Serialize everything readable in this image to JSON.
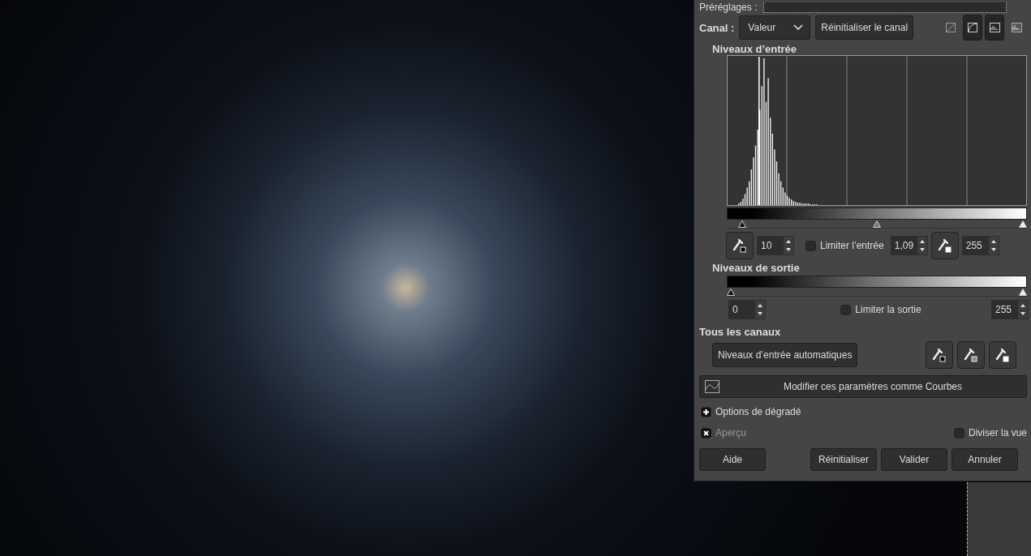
{
  "presets": {
    "label": "Préréglages :"
  },
  "channel": {
    "label": "Canal :",
    "value": "Valeur",
    "reset": "Réinitialiser le canal"
  },
  "view_toggles": [
    {
      "kind": "linear",
      "selected": false
    },
    {
      "kind": "log",
      "selected": true
    },
    {
      "kind": "histogram",
      "selected": true
    },
    {
      "kind": "histogram-alt",
      "selected": false
    }
  ],
  "input_levels": {
    "title": "Niveaux d’entrée",
    "black": "10",
    "gamma": "1,09",
    "white": "255",
    "clamp": {
      "label": "Limiter l’entrée",
      "checked": false
    },
    "markers": [
      {
        "kind": "black",
        "level": 0.04
      },
      {
        "kind": "gray",
        "level": 0.5
      },
      {
        "kind": "white",
        "level": 1
      }
    ]
  },
  "output_levels": {
    "title": "Niveaux de sortie",
    "low": "0",
    "high": "255",
    "clamp": {
      "label": "Limiter la sortie",
      "checked": false
    },
    "markers": [
      {
        "kind": "black",
        "level": 0
      },
      {
        "kind": "white",
        "level": 1
      }
    ]
  },
  "all_channels": {
    "title": "Tous les canaux",
    "auto": "Niveaux d’entrée automatiques",
    "pickers": [
      {
        "kind": "black"
      },
      {
        "kind": "gray"
      },
      {
        "kind": "white"
      }
    ]
  },
  "curves_button": "Modifier ces paramètres comme Courbes",
  "gradient_options": {
    "label": "Options de dégradé",
    "expanded": false
  },
  "preview": {
    "label": "Aperçu",
    "checked": true
  },
  "split_view": {
    "label": "Diviser la vue",
    "checked": false
  },
  "buttons": [
    "Aide",
    "Réinitialiser",
    "Valider",
    "Annuler"
  ]
}
